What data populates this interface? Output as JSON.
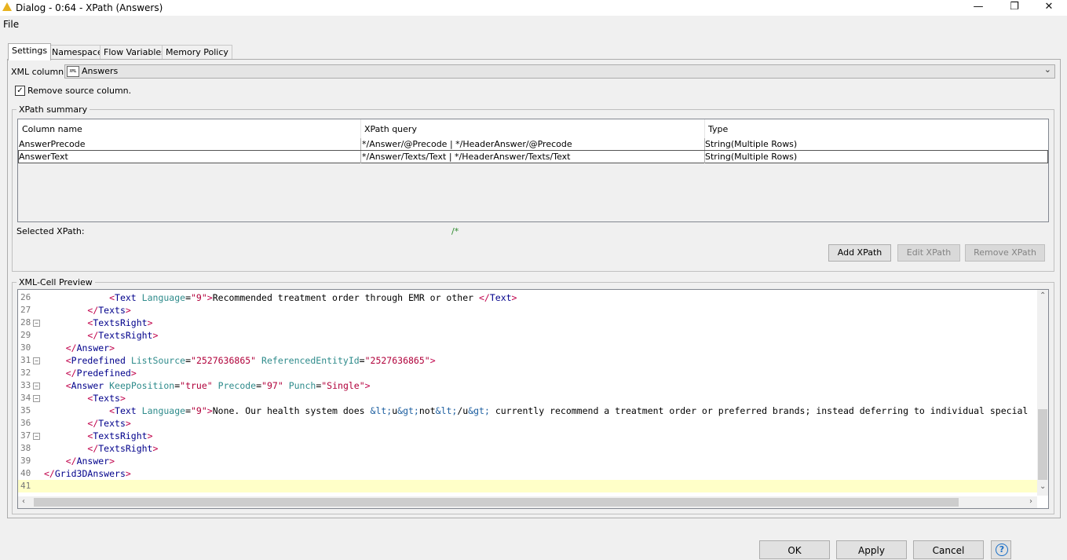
{
  "window": {
    "title": "Dialog - 0:64 - XPath (Answers)",
    "minimize_glyph": "—",
    "restore_glyph": "❐",
    "close_glyph": "✕"
  },
  "menu": {
    "file": "File"
  },
  "tabs": [
    {
      "label": "Settings",
      "active": true
    },
    {
      "label": "Namespace",
      "active": false
    },
    {
      "label": "Flow Variables",
      "active": false
    },
    {
      "label": "Memory Policy",
      "active": false
    }
  ],
  "settings": {
    "xml_column_label": "XML column:",
    "xml_column_badge": "XML",
    "xml_column_value": "Answers",
    "remove_source_label": "Remove source column.",
    "remove_source_checked": true
  },
  "xpath_summary": {
    "title": "XPath summary",
    "columns": [
      "Column name",
      "XPath query",
      "Type"
    ],
    "rows": [
      [
        "AnswerPrecode",
        "*/Answer/@Precode | */HeaderAnswer/@Precode",
        "String(Multiple Rows)"
      ],
      [
        "AnswerText",
        "*/Answer/Texts/Text | */HeaderAnswer/Texts/Text",
        "String(Multiple Rows)"
      ]
    ],
    "selected_label": "Selected XPath:",
    "selected_value": "/*",
    "add_button": "Add XPath",
    "edit_button": "Edit XPath",
    "remove_button": "Remove XPath"
  },
  "preview": {
    "title": "XML-Cell Preview",
    "lines": [
      {
        "n": "26",
        "fold": false,
        "indent": 3,
        "html": "<span class='tag'>&lt;</span><span class='tagname'>Text</span> <span class='attr'>Language</span>=<span class='val'>\"9\"</span><span class='tag'>&gt;</span>Recommended treatment order through EMR or other <span class='tag'>&lt;/</span><span class='tagname'>Text</span><span class='tag'>&gt;</span>"
      },
      {
        "n": "27",
        "fold": false,
        "indent": 2,
        "html": "<span class='tag'>&lt;/</span><span class='tagname'>Texts</span><span class='tag'>&gt;</span>"
      },
      {
        "n": "28",
        "fold": true,
        "indent": 2,
        "html": "<span class='tag'>&lt;</span><span class='tagname'>TextsRight</span><span class='tag'>&gt;</span>"
      },
      {
        "n": "29",
        "fold": false,
        "indent": 2,
        "html": "<span class='tag'>&lt;/</span><span class='tagname'>TextsRight</span><span class='tag'>&gt;</span>"
      },
      {
        "n": "30",
        "fold": false,
        "indent": 1,
        "html": "<span class='tag'>&lt;/</span><span class='tagname'>Answer</span><span class='tag'>&gt;</span>"
      },
      {
        "n": "31",
        "fold": true,
        "indent": 1,
        "html": "<span class='tag'>&lt;</span><span class='tagname'>Predefined</span> <span class='attr'>ListSource</span>=<span class='val'>\"2527636865\"</span> <span class='attr'>ReferencedEntityId</span>=<span class='val'>\"2527636865\"</span><span class='tag'>&gt;</span>"
      },
      {
        "n": "32",
        "fold": false,
        "indent": 1,
        "html": "<span class='tag'>&lt;/</span><span class='tagname'>Predefined</span><span class='tag'>&gt;</span>"
      },
      {
        "n": "33",
        "fold": true,
        "indent": 1,
        "html": "<span class='tag'>&lt;</span><span class='tagname'>Answer</span> <span class='attr'>KeepPosition</span>=<span class='val'>\"true\"</span> <span class='attr'>Precode</span>=<span class='val'>\"97\"</span> <span class='attr'>Punch</span>=<span class='val'>\"Single\"</span><span class='tag'>&gt;</span>"
      },
      {
        "n": "34",
        "fold": true,
        "indent": 2,
        "html": "<span class='tag'>&lt;</span><span class='tagname'>Texts</span><span class='tag'>&gt;</span>"
      },
      {
        "n": "35",
        "fold": false,
        "indent": 3,
        "html": "<span class='tag'>&lt;</span><span class='tagname'>Text</span> <span class='attr'>Language</span>=<span class='val'>\"9\"</span><span class='tag'>&gt;</span>None. Our health system does <span class='ent'>&amp;lt;</span>u<span class='ent'>&amp;gt;</span>not<span class='ent'>&amp;lt;</span>/u<span class='ent'>&amp;gt;</span> currently recommend a treatment order or preferred brands; instead deferring to individual special"
      },
      {
        "n": "36",
        "fold": false,
        "indent": 2,
        "html": "<span class='tag'>&lt;/</span><span class='tagname'>Texts</span><span class='tag'>&gt;</span>"
      },
      {
        "n": "37",
        "fold": true,
        "indent": 2,
        "html": "<span class='tag'>&lt;</span><span class='tagname'>TextsRight</span><span class='tag'>&gt;</span>"
      },
      {
        "n": "38",
        "fold": false,
        "indent": 2,
        "html": "<span class='tag'>&lt;/</span><span class='tagname'>TextsRight</span><span class='tag'>&gt;</span>"
      },
      {
        "n": "39",
        "fold": false,
        "indent": 1,
        "html": "<span class='tag'>&lt;/</span><span class='tagname'>Answer</span><span class='tag'>&gt;</span>"
      },
      {
        "n": "40",
        "fold": false,
        "indent": 0,
        "html": "<span class='tag'>&lt;/</span><span class='tagname'>Grid3DAnswers</span><span class='tag'>&gt;</span>"
      },
      {
        "n": "41",
        "fold": false,
        "indent": 0,
        "html": ""
      }
    ]
  },
  "footer": {
    "ok": "OK",
    "apply": "Apply",
    "cancel": "Cancel",
    "help": "?"
  }
}
